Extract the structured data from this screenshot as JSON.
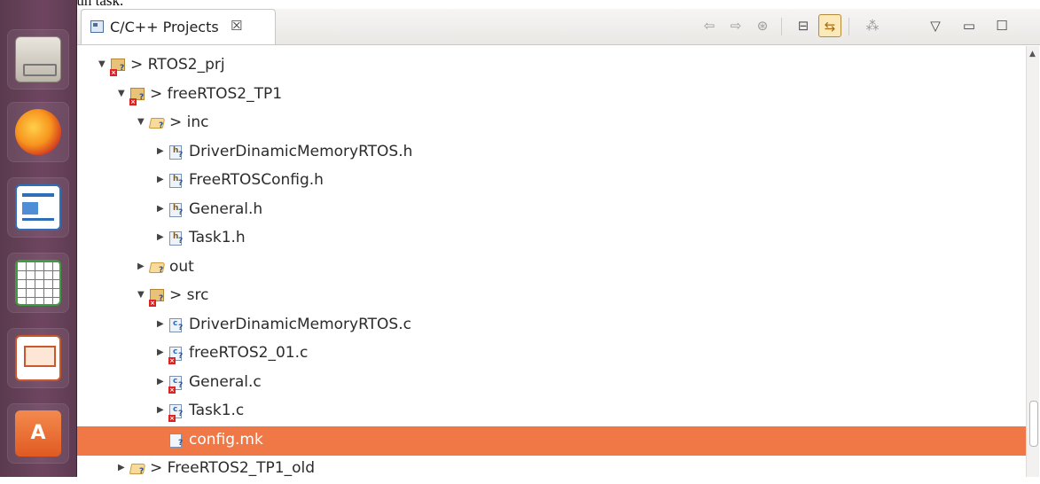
{
  "doc_fragment": "el handle de un task.",
  "launcher": {
    "items": [
      {
        "name": "files",
        "color": "#cfc9bf"
      },
      {
        "name": "firefox",
        "color": "#e86b1f"
      },
      {
        "name": "writer",
        "color": "#2f7fd1"
      },
      {
        "name": "calc",
        "color": "#4caf50"
      },
      {
        "name": "impress",
        "color": "#e0672b"
      },
      {
        "name": "software-center",
        "color": "#e96b2c"
      }
    ]
  },
  "view": {
    "tab_title": "C/C++ Projects",
    "tab_close": "☒",
    "toolbar": {
      "back": "⇦",
      "forward": "⇨",
      "home": "⊛",
      "collapse": "⊟",
      "link": "⇆",
      "filter": "⁂",
      "menu": "▽",
      "minimize": "▭",
      "maximize": "☐"
    }
  },
  "tree": [
    {
      "label": "> RTOS2_prj",
      "depth": 0,
      "expander": "▼",
      "icon": "project",
      "error": true
    },
    {
      "label": "> freeRTOS2_TP1",
      "depth": 1,
      "expander": "▼",
      "icon": "project",
      "error": true
    },
    {
      "label": "> inc",
      "depth": 2,
      "expander": "▼",
      "icon": "folder-open",
      "error": false
    },
    {
      "label": "DriverDinamicMemoryRTOS.h",
      "depth": 3,
      "expander": "▶",
      "icon": "h-file",
      "error": false
    },
    {
      "label": "FreeRTOSConfig.h",
      "depth": 3,
      "expander": "▶",
      "icon": "h-file",
      "error": false
    },
    {
      "label": "General.h",
      "depth": 3,
      "expander": "▶",
      "icon": "h-file",
      "error": false
    },
    {
      "label": "Task1.h",
      "depth": 3,
      "expander": "▶",
      "icon": "h-file",
      "error": false
    },
    {
      "label": "out",
      "depth": 2,
      "expander": "▶",
      "icon": "folder",
      "error": false
    },
    {
      "label": "> src",
      "depth": 2,
      "expander": "▼",
      "icon": "project",
      "error": true
    },
    {
      "label": "DriverDinamicMemoryRTOS.c",
      "depth": 3,
      "expander": "▶",
      "icon": "c-file",
      "error": false
    },
    {
      "label": "freeRTOS2_01.c",
      "depth": 3,
      "expander": "▶",
      "icon": "c-file",
      "error": true
    },
    {
      "label": "General.c",
      "depth": 3,
      "expander": "▶",
      "icon": "c-file",
      "error": true
    },
    {
      "label": "Task1.c",
      "depth": 3,
      "expander": "▶",
      "icon": "c-file",
      "error": true
    },
    {
      "label": "config.mk",
      "depth": 3,
      "expander": "",
      "icon": "mk-file",
      "error": false,
      "selected": true
    },
    {
      "label": "> FreeRTOS2_TP1_old",
      "depth": 1,
      "expander": "▶",
      "icon": "folder-open",
      "error": false
    }
  ]
}
